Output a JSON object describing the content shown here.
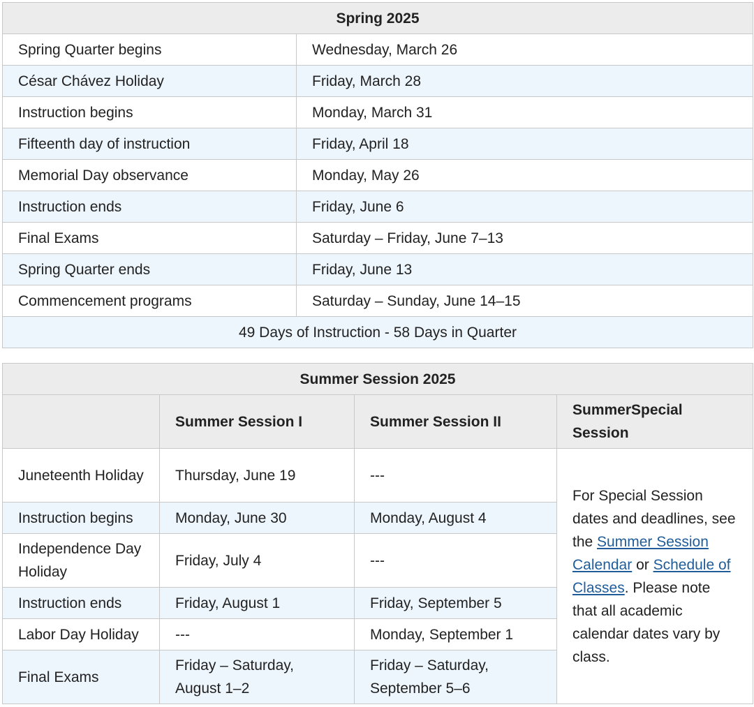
{
  "spring": {
    "title": "Spring 2025",
    "rows": [
      {
        "event": "Spring Quarter begins",
        "date": "Wednesday, March 26"
      },
      {
        "event": "César Chávez Holiday",
        "date": "Friday, March 28"
      },
      {
        "event": "Instruction begins",
        "date": "Monday, March 31"
      },
      {
        "event": "Fifteenth day of instruction",
        "date": "Friday, April 18"
      },
      {
        "event": "Memorial Day observance",
        "date": "Monday, May 26"
      },
      {
        "event": "Instruction ends",
        "date": "Friday, June 6"
      },
      {
        "event": "Final Exams",
        "date": "Saturday – Friday, June 7–13"
      },
      {
        "event": "Spring Quarter ends",
        "date": "Friday, June 13"
      },
      {
        "event": "Commencement programs",
        "date": "Saturday – Sunday, June 14–15"
      }
    ],
    "footer": "49 Days of Instruction - 58 Days in Quarter"
  },
  "summer": {
    "title": "Summer Session 2025",
    "columns": [
      "",
      "Summer Session I",
      "Summer Session II",
      "SummerSpecial Session"
    ],
    "rows": [
      {
        "event": "Juneteenth Holiday",
        "s1": "Thursday, June 19",
        "s2": "---"
      },
      {
        "event": "Instruction begins",
        "s1": "Monday, June 30",
        "s2": "Monday, August 4"
      },
      {
        "event": "Independence Day Holiday",
        "s1": "Friday, July 4",
        "s2": "---"
      },
      {
        "event": "Instruction ends",
        "s1": "Friday, August 1",
        "s2": "Friday, September 5"
      },
      {
        "event": "Labor Day Holiday",
        "s1": "---",
        "s2": "Monday, September 1"
      },
      {
        "event": "Final Exams",
        "s1": "Friday – Saturday, August 1–2",
        "s2": "Friday – Saturday, September 5–6"
      }
    ],
    "special": {
      "text1": "For Special Session dates and deadlines, see the ",
      "link1": "Summer Session Calendar",
      "text2": " or ",
      "link2": "Schedule of Classes",
      "text3": ". Please note that all academic calendar dates vary by class."
    }
  },
  "colors": {
    "header_bg": "#ececec",
    "alt_row_bg": "#eef6fd",
    "border": "#c8c8c8",
    "link": "#1f5c99"
  }
}
